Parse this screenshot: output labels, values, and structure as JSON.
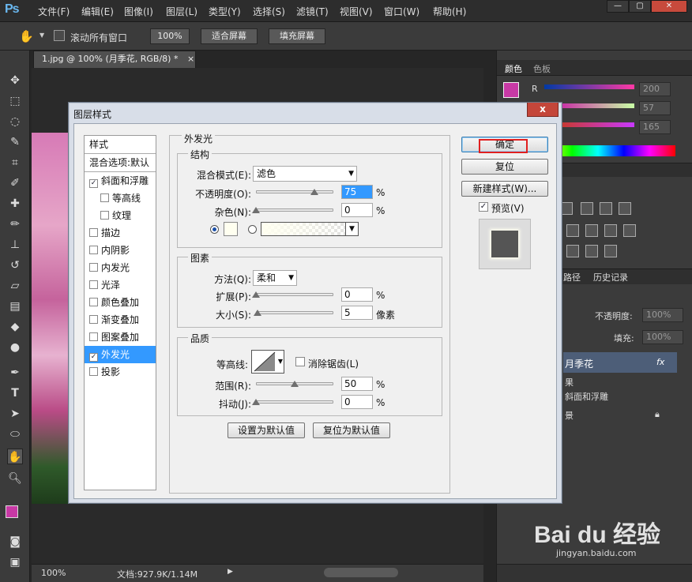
{
  "app": {
    "logo": "Ps"
  },
  "menu": [
    "文件(F)",
    "编辑(E)",
    "图像(I)",
    "图层(L)",
    "类型(Y)",
    "选择(S)",
    "滤镜(T)",
    "视图(V)",
    "窗口(W)",
    "帮助(H)"
  ],
  "window_controls": {
    "minimize": "—",
    "restore": "▢",
    "close": "✕"
  },
  "options_bar": {
    "hand_icon": "✋",
    "scroll_all_label": "滚动所有窗口",
    "zoom_100": "100%",
    "fit_screen": "适合屏幕",
    "fill_screen": "填充屏幕"
  },
  "document": {
    "tab_title": "1.jpg @ 100% (月季花, RGB/8) *",
    "close": "×"
  },
  "status": {
    "zoom": "100%",
    "doc_info": "文档:927.9K/1.14M"
  },
  "right_panel": {
    "tabs_top": [
      "颜色",
      "色板"
    ],
    "color": {
      "r_label": "R",
      "r": "200",
      "g": "57",
      "b": "165",
      "fg": "#c839a5"
    },
    "tabs_mid": [
      "路径",
      "历史记录"
    ],
    "opacity_label": "不透明度:",
    "opacity_value": "100%",
    "fill_label": "填充:",
    "fill_value": "100%",
    "layers": {
      "name": "月季花",
      "fx": "fx",
      "effects_label": "果",
      "effect_item": "斜面和浮雕",
      "bg_label": "景"
    }
  },
  "watermark": {
    "brand": "Bai du 经验",
    "url": "jingyan.baidu.com"
  },
  "dialog": {
    "title": "图层样式",
    "close": "x",
    "styles_header": "样式",
    "blend_options": "混合选项:默认",
    "items": [
      {
        "label": "斜面和浮雕",
        "checked": true,
        "sub": false
      },
      {
        "label": "等高线",
        "checked": false,
        "sub": true
      },
      {
        "label": "纹理",
        "checked": false,
        "sub": true
      },
      {
        "label": "描边",
        "checked": false,
        "sub": false
      },
      {
        "label": "内阴影",
        "checked": false,
        "sub": false
      },
      {
        "label": "内发光",
        "checked": false,
        "sub": false
      },
      {
        "label": "光泽",
        "checked": false,
        "sub": false
      },
      {
        "label": "颜色叠加",
        "checked": false,
        "sub": false
      },
      {
        "label": "渐变叠加",
        "checked": false,
        "sub": false
      },
      {
        "label": "图案叠加",
        "checked": false,
        "sub": false
      },
      {
        "label": "外发光",
        "checked": true,
        "sub": false,
        "selected": true
      },
      {
        "label": "投影",
        "checked": false,
        "sub": false
      }
    ],
    "outer_glow": {
      "section_title": "外发光",
      "structure": {
        "legend": "结构",
        "blend_mode_label": "混合模式(E):",
        "blend_mode_value": "滤色",
        "opacity_label": "不透明度(O):",
        "opacity_value": "75",
        "opacity_unit": "%",
        "opacity_level": 0.75,
        "noise_label": "杂色(N):",
        "noise_value": "0",
        "noise_unit": "%",
        "noise_level": 0
      },
      "elements": {
        "legend": "图素",
        "technique_label": "方法(Q):",
        "technique_value": "柔和",
        "spread_label": "扩展(P):",
        "spread_value": "0",
        "spread_unit": "%",
        "spread_level": 0,
        "size_label": "大小(S):",
        "size_value": "5",
        "size_unit": "像素",
        "size_level": 0.02
      },
      "quality": {
        "legend": "品质",
        "contour_label": "等高线:",
        "antialias_label": "消除锯齿(L)",
        "range_label": "范围(R):",
        "range_value": "50",
        "range_unit": "%",
        "range_level": 0.5,
        "jitter_label": "抖动(J):",
        "jitter_value": "0",
        "jitter_unit": "%",
        "jitter_level": 0
      },
      "set_default": "设置为默认值",
      "reset_default": "复位为默认值"
    },
    "buttons": {
      "ok": "确定",
      "reset": "复位",
      "new_style": "新建样式(W)...",
      "preview_label": "预览(V)"
    },
    "colors": {
      "highlight": "#e02020",
      "selected_row": "#3399ff"
    }
  }
}
